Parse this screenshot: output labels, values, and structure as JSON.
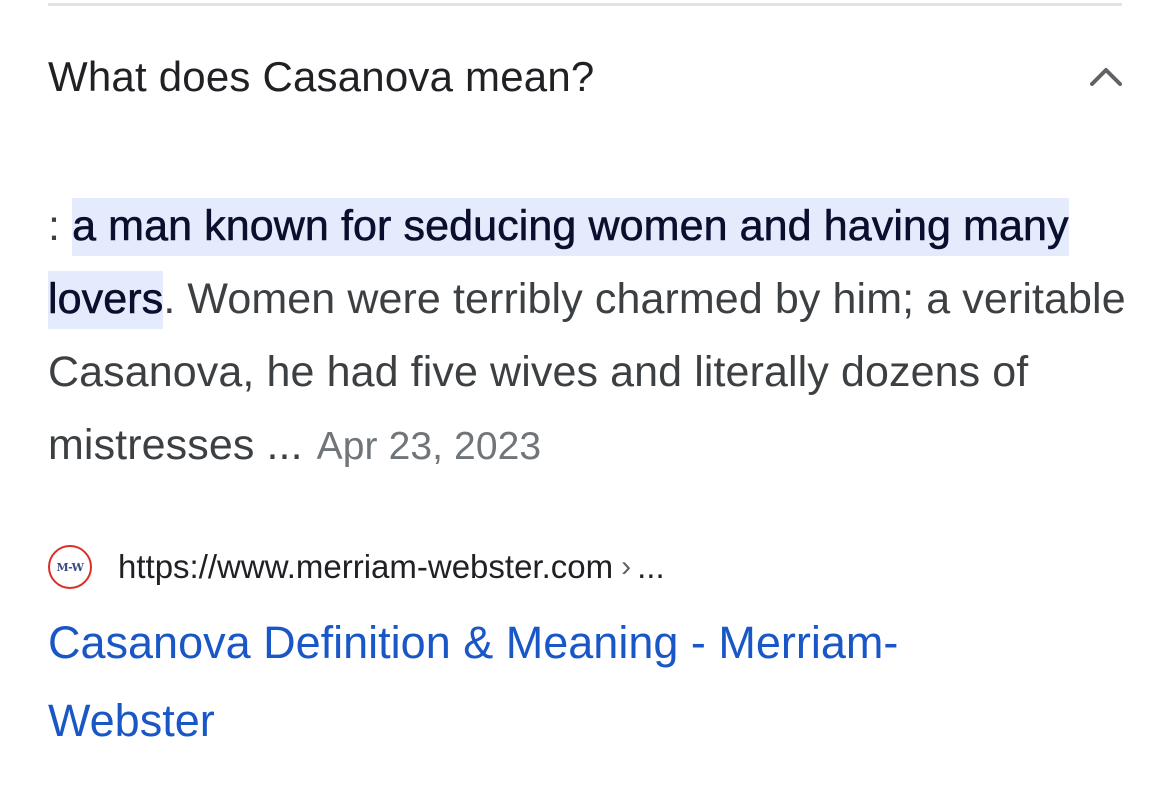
{
  "question": {
    "text": "What does Casanova mean?",
    "toggle_icon": "chevron-up-icon"
  },
  "snippet": {
    "prefix": ": ",
    "highlight": "a man known for seducing women and having many lovers",
    "period": ".",
    "rest": " Women were terribly charmed by him; a veritable Casanova, he had five wives and literally dozens of mistresses ...",
    "date": "Apr 23, 2023"
  },
  "source": {
    "favicon_text": "M-W",
    "url": "https://www.merriam-webster.com",
    "separator": "›",
    "ellipsis": "..."
  },
  "result": {
    "title": "Casanova Definition & Meaning - Merriam-Webster"
  },
  "colors": {
    "link": "#1a57c6",
    "highlight_bg": "#e3ebfc",
    "favicon_ring": "#d93025"
  }
}
